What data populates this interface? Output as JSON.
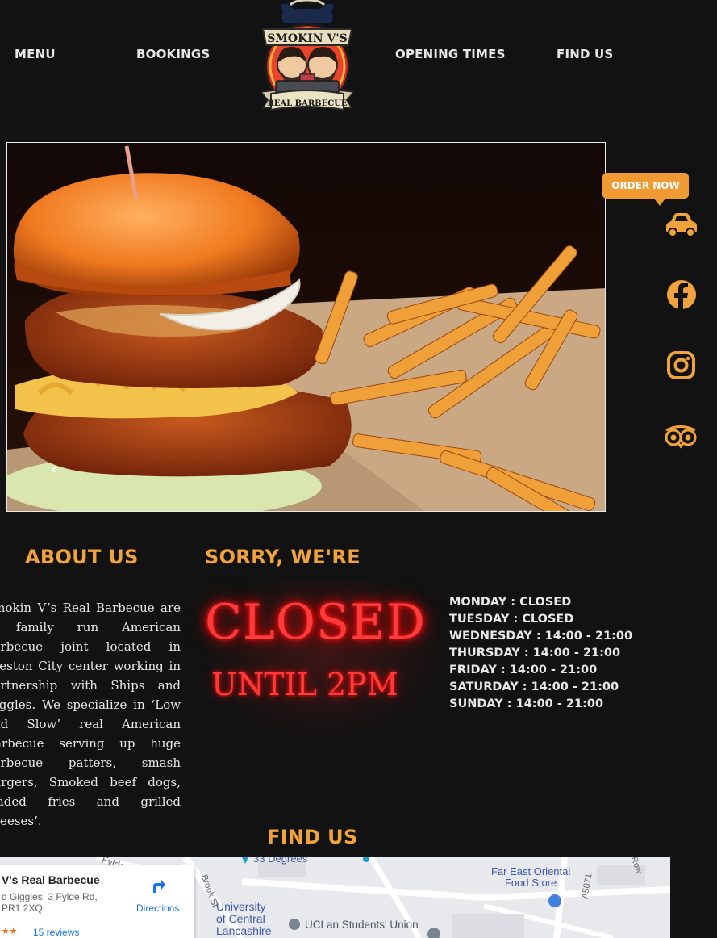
{
  "nav": {
    "menu": "MENU",
    "bookings": "BOOKINGS",
    "opening_times": "OPENING TIMES",
    "find_us": "FIND US"
  },
  "logo": {
    "top_text": "SMOKIN V'S",
    "banner_text": "REAL BARBECUE"
  },
  "hero": {
    "image_subject": "fried chicken burger with mac and cheese and seasoned fries",
    "prev_arrow": "‹"
  },
  "side": {
    "order_now": "ORDER NOW",
    "icons": [
      "car-icon",
      "facebook-icon",
      "instagram-icon",
      "tripadvisor-icon"
    ]
  },
  "about": {
    "title": "ABOUT US",
    "text": "Smokin V’s Real Barbecue are a family run American barbecue joint located in Preston City center working in partnership with Ships and Giggles. We specialize in ‘Low and Slow’ real American Barbecue serving up huge barbecue patters, smash burgers, Smoked beef dogs, loaded fries and grilled cheeses’."
  },
  "status": {
    "title": "SORRY, WE'RE",
    "closed": "CLOSED",
    "until": "UNTIL 2PM"
  },
  "hours": [
    "MONDAY : CLOSED",
    "TUESDAY : CLOSED",
    "WEDNESDAY : 14:00 - 21:00",
    "THURSDAY : 14:00 - 21:00",
    "FRIDAY : 14:00 - 21:00",
    "SATURDAY : 14:00 - 21:00",
    "SUNDAY : 14:00 - 21:00"
  ],
  "find_us": {
    "title": "FIND US",
    "map": {
      "place_name": "V's Real Barbecue",
      "address_line1": "d Giggles, 3 Fylde Rd,",
      "address_line2": "PR1 2XQ",
      "reviews": "15 reviews",
      "directions": "Directions",
      "labels": {
        "fylde": "Fylde",
        "degrees": "33 Degrees",
        "brook_st": "Brook St",
        "university": "University\nof Central\nLancashire",
        "students_union": "UCLan Students' Union",
        "far_east": "Far East Oriental\nFood Store",
        "a5071": "A5071",
        "row": "Row"
      }
    }
  },
  "colors": {
    "background": "#121212",
    "accent": "#f0a23d",
    "neon_red": "#ff3a3a"
  }
}
